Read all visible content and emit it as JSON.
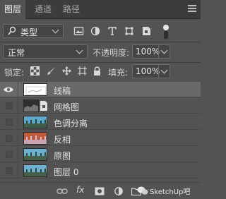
{
  "tabs": [
    {
      "label": "图层",
      "active": true
    },
    {
      "label": "通道",
      "active": false
    },
    {
      "label": "路径",
      "active": false
    }
  ],
  "filter": {
    "kind_label": "类型",
    "icons": [
      "image-filter-icon",
      "adjustment-filter-icon",
      "type-filter-icon",
      "shape-filter-icon",
      "smart-object-filter-icon"
    ]
  },
  "blend": {
    "mode": "正常",
    "opacity_label": "不透明度:",
    "opacity_value": "100%"
  },
  "lock": {
    "label": "锁定:",
    "fill_label": "填充:",
    "fill_value": "100%"
  },
  "layers": [
    {
      "name": "线稿",
      "visible": true,
      "selected": true,
      "thumb": "sketch"
    },
    {
      "name": "网格图",
      "visible": false,
      "selected": false,
      "thumb": "grid",
      "linked_icon": true
    },
    {
      "name": "色调分离",
      "visible": false,
      "selected": false,
      "thumb": "sky"
    },
    {
      "name": "反相",
      "visible": false,
      "selected": false,
      "thumb": "inverted"
    },
    {
      "name": "原图",
      "visible": false,
      "selected": false,
      "thumb": "sky"
    },
    {
      "name": "图层 0",
      "visible": false,
      "selected": false,
      "thumb": "sky"
    }
  ],
  "bottom": {
    "icons": [
      "link-layers-icon",
      "fx-icon",
      "add-mask-icon",
      "adjustment-layer-icon",
      "new-group-icon"
    ],
    "fx_label": "fx",
    "watermark": "SketchUp吧"
  },
  "colors": {
    "panel": "#535353",
    "tabbar": "#3c3c3c",
    "selected_row": "#696969",
    "field": "#454545"
  }
}
